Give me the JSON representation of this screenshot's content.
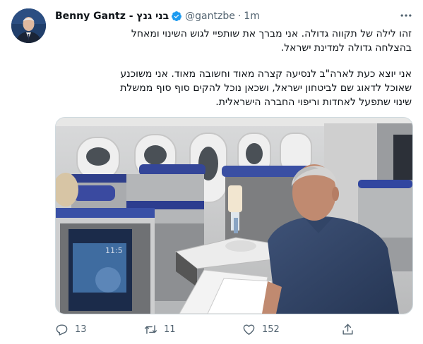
{
  "tweet": {
    "author_name": "Benny Gantz - בני גנץ",
    "handle": "@gantzbe",
    "separator": "·",
    "time": "1m",
    "paragraph1_line1": "זהו לילה של תקווה גדולה. אני מברך את שותפיי לגוש השינוי ומאחל",
    "paragraph1_line2": "בהצלחה גדולה למדינת ישראל.",
    "paragraph2_line1": "אני יוצא כעת לארה\"ב לנסיעה קצרה מאוד וחשובה מאוד. אני משוכנע",
    "paragraph2_line2": "שאוכל לדאוג שם לביטחון ישראל, ושכאן נוכל להקים סוף סוף ממשלת",
    "paragraph2_line3": "שינוי שתפעל לאחדות וריפוי החברה הישראלית."
  },
  "actions": {
    "reply_count": "13",
    "retweet_count": "11",
    "like_count": "152"
  },
  "icons": [
    "verified-badge-icon",
    "more-options-icon",
    "reply-icon",
    "retweet-icon",
    "like-icon",
    "share-icon"
  ],
  "colors": {
    "verified": "#1d9bf0",
    "secondary_text": "#536471"
  }
}
